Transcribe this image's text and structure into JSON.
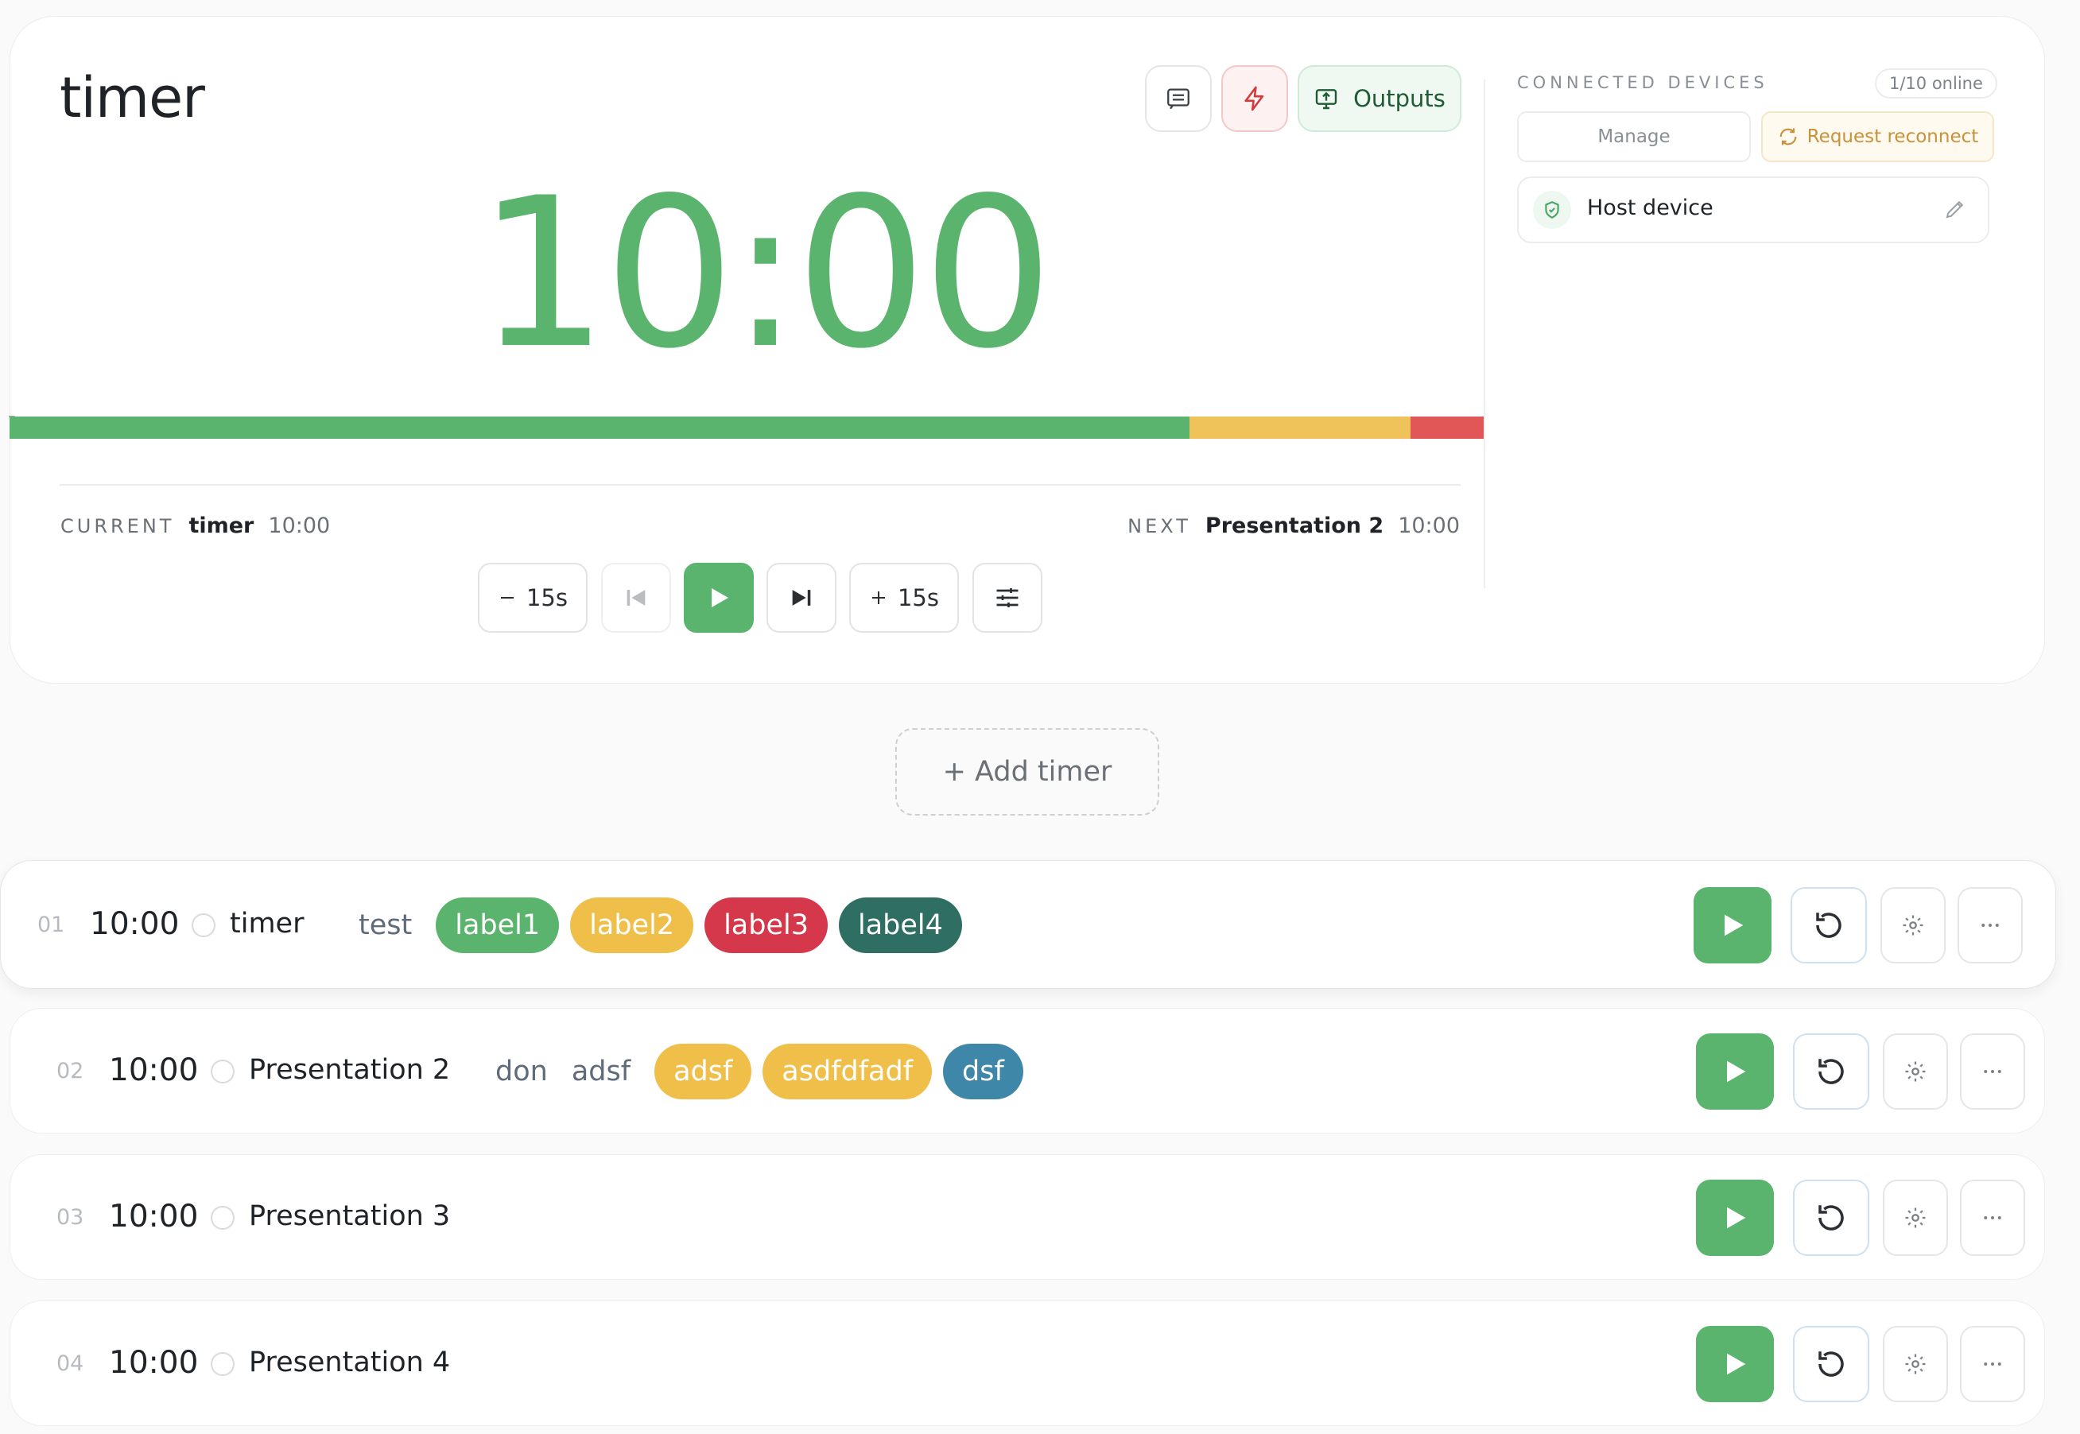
{
  "header": {
    "title": "timer",
    "outputs_label": "Outputs"
  },
  "clock": {
    "time": "10:00",
    "color": "#5bb46e"
  },
  "progress": {
    "marker": "7",
    "segments": [
      {
        "name": "green",
        "fraction": 0.8,
        "color": "#5bb46e"
      },
      {
        "name": "yellow",
        "fraction": 0.15,
        "color": "#efc35a"
      },
      {
        "name": "red",
        "fraction": 0.05,
        "color": "#e15656"
      }
    ]
  },
  "current": {
    "key": "CURRENT",
    "name": "timer",
    "time": "10:00"
  },
  "next": {
    "key": "NEXT",
    "name": "Presentation 2",
    "time": "10:00"
  },
  "controls": {
    "minus_label": "15s",
    "plus_label": "15s"
  },
  "devices": {
    "title": "CONNECTED DEVICES",
    "online": "1/10 online",
    "manage_label": "Manage",
    "reconnect_label": "Request reconnect",
    "host_label": "Host device"
  },
  "add_timer_label": "+ Add timer",
  "timers": [
    {
      "num": "01",
      "duration": "10:00",
      "title": "timer",
      "notes": [
        "test"
      ],
      "labels": [
        {
          "text": "label1",
          "color": "#5bb46e"
        },
        {
          "text": "label2",
          "color": "#efbf4a"
        },
        {
          "text": "label3",
          "color": "#d5384a"
        },
        {
          "text": "label4",
          "color": "#2f6f63"
        }
      ]
    },
    {
      "num": "02",
      "duration": "10:00",
      "title": "Presentation 2",
      "notes": [
        "don",
        "adsf"
      ],
      "labels": [
        {
          "text": "adsf",
          "color": "#efbf4a"
        },
        {
          "text": "asdfdfadf",
          "color": "#efbf4a"
        },
        {
          "text": "dsf",
          "color": "#3f87a8"
        }
      ]
    },
    {
      "num": "03",
      "duration": "10:00",
      "title": "Presentation 3",
      "notes": [],
      "labels": []
    },
    {
      "num": "04",
      "duration": "10:00",
      "title": "Presentation 4",
      "notes": [],
      "labels": []
    }
  ]
}
